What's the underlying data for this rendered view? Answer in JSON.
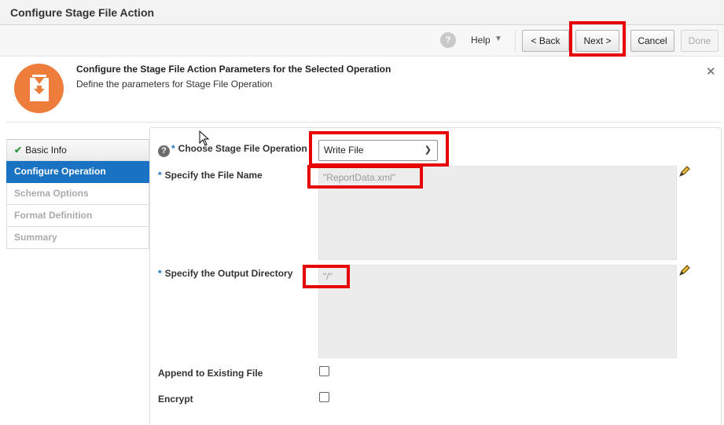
{
  "window": {
    "title": "Configure Stage File Action"
  },
  "toolbar": {
    "help_icon": "user-help-icon",
    "help_label": "Help",
    "help_caret": "▼",
    "back_label": "< Back",
    "next_label": "Next >",
    "cancel_label": "Cancel",
    "done_label": "Done"
  },
  "header": {
    "icon": "stage-file-icon",
    "title": "Configure the Stage File Action Parameters for the Selected Operation",
    "subtitle": "Define the parameters for Stage File Operation",
    "close": "✕"
  },
  "nav": {
    "items": [
      {
        "label": "Basic Info",
        "state": "completed"
      },
      {
        "label": "Configure Operation",
        "state": "active"
      },
      {
        "label": "Schema Options",
        "state": "disabled"
      },
      {
        "label": "Format Definition",
        "state": "disabled"
      },
      {
        "label": "Summary",
        "state": "disabled"
      }
    ]
  },
  "form": {
    "operation_label": "Choose Stage File Operation",
    "operation_value": "Write File",
    "file_name_label": "Specify the File Name",
    "file_name_value": "\"ReportData.xml\"",
    "output_dir_label": "Specify the Output Directory",
    "output_dir_value": "\"/\"",
    "append_label": "Append to Existing File",
    "append_checked": false,
    "encrypt_label": "Encrypt",
    "encrypt_checked": false,
    "required_marker": "*"
  },
  "colors": {
    "accent_blue": "#1a73c2",
    "highlight_red": "#e60000",
    "icon_orange": "#ee7c3a"
  }
}
